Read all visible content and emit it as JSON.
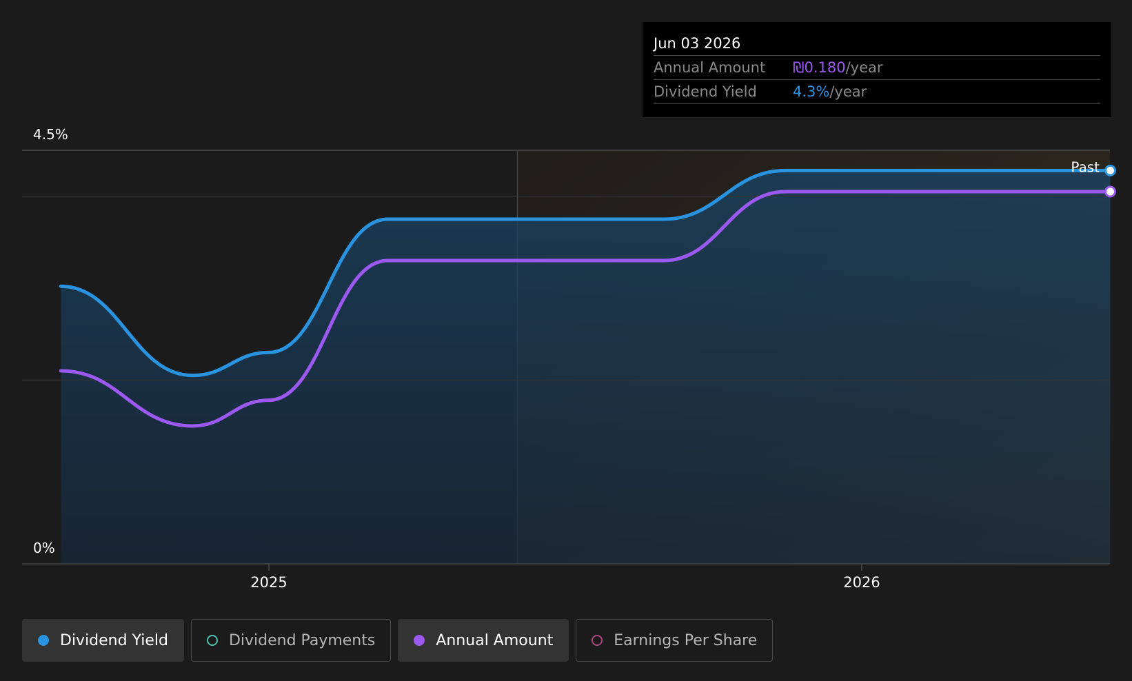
{
  "tooltip": {
    "date": "Jun 03 2026",
    "rows": [
      {
        "label": "Annual Amount",
        "value": "₪0.180",
        "suffix": "/year",
        "color": "#9b59f0"
      },
      {
        "label": "Dividend Yield",
        "value": "4.3%",
        "suffix": "/year",
        "color": "#2a93e0"
      }
    ]
  },
  "legend": [
    {
      "label": "Dividend Yield",
      "color": "#2a93e0",
      "active": true
    },
    {
      "label": "Dividend Payments",
      "color": "#4fc1b0",
      "active": false
    },
    {
      "label": "Annual Amount",
      "color": "#9b59f0",
      "active": true
    },
    {
      "label": "Earnings Per Share",
      "color": "#b0457e",
      "active": false
    }
  ],
  "chart_data": {
    "type": "line",
    "y_tick_labels": [
      "4.5%",
      "0%"
    ],
    "x_tick_labels": [
      "2025",
      "2026"
    ],
    "ylim": [
      0,
      4.5
    ],
    "past_label": "Past",
    "series": [
      {
        "name": "Dividend Yield",
        "color": "#2a93e0",
        "points": [
          [
            "2024-08-26",
            3.02
          ],
          [
            "2024-11-15",
            2.05
          ],
          [
            "2025-01-01",
            2.3
          ],
          [
            "2025-03-15",
            3.75
          ],
          [
            "2025-09-01",
            3.75
          ],
          [
            "2025-11-15",
            4.28
          ],
          [
            "2026-06-03",
            4.28
          ]
        ]
      },
      {
        "name": "Annual Amount",
        "color": "#9b59f0",
        "points": [
          [
            "2024-08-26",
            2.1
          ],
          [
            "2024-11-15",
            1.5
          ],
          [
            "2025-01-01",
            1.78
          ],
          [
            "2025-03-15",
            3.3
          ],
          [
            "2025-09-01",
            3.3
          ],
          [
            "2025-11-15",
            4.05
          ],
          [
            "2026-06-03",
            4.05
          ]
        ]
      }
    ],
    "forecast_start": "2025-06-03"
  }
}
